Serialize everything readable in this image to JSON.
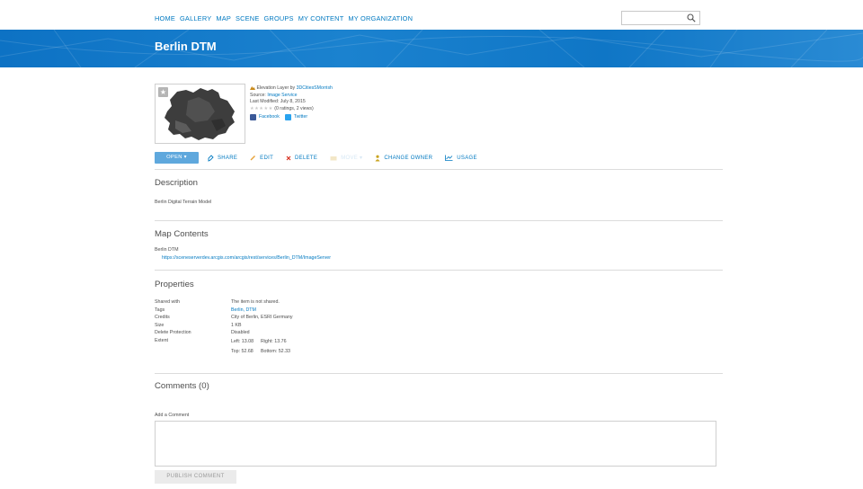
{
  "nav": [
    "HOME",
    "GALLERY",
    "MAP",
    "SCENE",
    "GROUPS",
    "MY CONTENT",
    "MY ORGANIZATION"
  ],
  "search": {
    "placeholder": ""
  },
  "banner": {
    "title": "Berlin DTM",
    "color": "#0f76c6"
  },
  "item": {
    "type_prefix": "Elevation Layer by ",
    "owner": "3DCitiesSMorrish",
    "source_label": "Source: ",
    "source": "Image Service",
    "modified": "Last Modified: July 8, 2015",
    "stars": "★★★★★",
    "ratings": "(0 ratings, 2 views)",
    "facebook": "Facebook",
    "twitter": "Twitter"
  },
  "actions": {
    "open": "OPEN ▾",
    "share": "SHARE",
    "edit": "EDIT",
    "delete": "DELETE",
    "move": "MOVE ▾",
    "change_owner": "CHANGE OWNER",
    "usage": "USAGE"
  },
  "description": {
    "title": "Description",
    "text": "Berlin Digital Terrain Model"
  },
  "map_contents": {
    "title": "Map Contents",
    "layer": "Berlin DTM",
    "url": "https://sceneserverdev.arcgis.com/arcgis/rest/services/Berlin_DTM/ImageServer"
  },
  "properties": {
    "title": "Properties",
    "rows": [
      {
        "label": "Shared with",
        "value": "The item is not shared."
      },
      {
        "label": "Tags",
        "value": "Berlin, DTM"
      },
      {
        "label": "Credits",
        "value": "City of Berlin, ESRI Germany"
      },
      {
        "label": "Size",
        "value": "1 KB"
      },
      {
        "label": "Delete Protection",
        "value": "Disabled"
      },
      {
        "label": "Extent",
        "value": ""
      }
    ],
    "extent": {
      "left": "Left: 13.08",
      "right": "Right:   13.76",
      "top": "Top: 52.68",
      "bottom": "Bottom: 52.33"
    }
  },
  "comments": {
    "title": "Comments (0)",
    "add_label": "Add a Comment",
    "publish": "PUBLISH COMMENT"
  }
}
